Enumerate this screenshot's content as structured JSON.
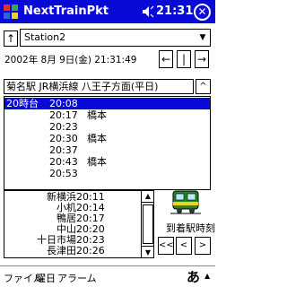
{
  "titlebar": {
    "title": "NextTrainPkt",
    "time": "21:31",
    "close_label": "ok"
  },
  "station": {
    "value": "Station2"
  },
  "datetime": {
    "text": "2002年 8月 9日(金) 21:31:49"
  },
  "nav": {
    "up": "↑",
    "prev": "←",
    "now": "|",
    "next": "→"
  },
  "line": {
    "header": "菊名駅 JR横浜線 八王子方面(平日)",
    "scroll_up": "^"
  },
  "timetable": {
    "rows": [
      {
        "hour": "20時台",
        "time": "20:08",
        "dest": "",
        "selected": true
      },
      {
        "hour": "",
        "time": "20:17",
        "dest": "橋本"
      },
      {
        "hour": "",
        "time": "20:23",
        "dest": ""
      },
      {
        "hour": "",
        "time": "20:30",
        "dest": "橋本"
      },
      {
        "hour": "",
        "time": "20:37",
        "dest": ""
      },
      {
        "hour": "",
        "time": "20:43",
        "dest": "橋本"
      },
      {
        "hour": "",
        "time": "20:53",
        "dest": ""
      }
    ]
  },
  "stops": {
    "rows": [
      {
        "name": "新横浜",
        "time": "20:11"
      },
      {
        "name": "小机",
        "time": "20:14"
      },
      {
        "name": "鴨居",
        "time": "20:17"
      },
      {
        "name": "中山",
        "time": "20:20"
      },
      {
        "name": "十日市場",
        "time": "20:23"
      },
      {
        "name": "長津田",
        "time": "20:26"
      }
    ]
  },
  "arrival": {
    "label": "到着駅時刻",
    "first": "<<",
    "back": "<",
    "fwd": ">"
  },
  "menubar": {
    "file": "ファイル",
    "week": "曜日",
    "alarm": "アラーム",
    "ime": "あ"
  }
}
